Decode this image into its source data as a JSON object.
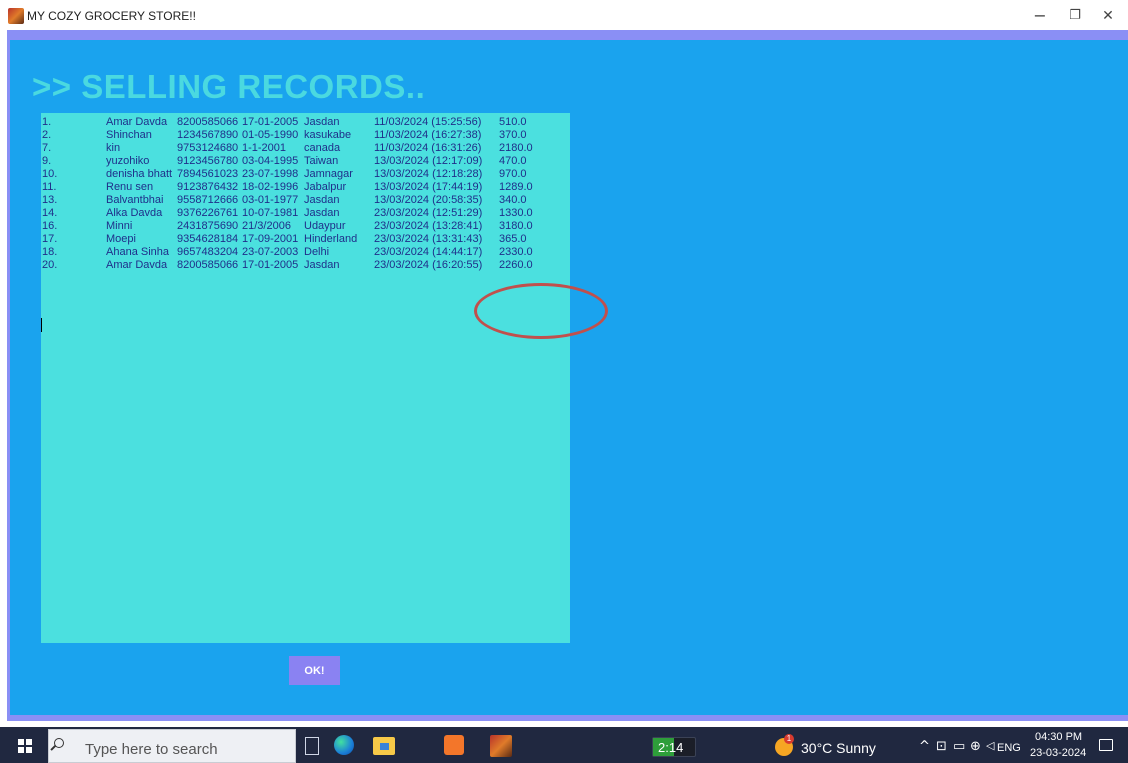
{
  "window": {
    "title": "MY COZY GROCERY STORE!!",
    "minimize_glyph": "−",
    "restore_glyph": "❐",
    "close_glyph": "✕"
  },
  "page": {
    "heading": ">> SELLING RECORDS..",
    "ok_label": "OK!"
  },
  "records": [
    [
      "1.",
      "Amar Davda",
      "8200585066",
      "17-01-2005",
      "Jasdan",
      "11/03/2024 (15:25:56)",
      "510.0"
    ],
    [
      "2.",
      "Shinchan",
      "1234567890",
      "01-05-1990",
      "kasukabe",
      "11/03/2024 (16:27:38)",
      "370.0"
    ],
    [
      "7.",
      "kin",
      "9753124680",
      "1-1-2001",
      "canada",
      "11/03/2024 (16:31:26)",
      "2180.0"
    ],
    [
      "9.",
      "yuzohiko",
      "9123456780",
      "03-04-1995",
      "Taiwan",
      "13/03/2024 (12:17:09)",
      "470.0"
    ],
    [
      "10.",
      "denisha bhatt",
      "7894561023",
      "23-07-1998",
      "Jamnagar",
      "13/03/2024 (12:18:28)",
      "970.0"
    ],
    [
      "11.",
      "Renu sen",
      "9123876432",
      "18-02-1996",
      "Jabalpur",
      "13/03/2024 (17:44:19)",
      "1289.0"
    ],
    [
      "13.",
      "Balvantbhai",
      "9558712666",
      "03-01-1977",
      "Jasdan",
      "13/03/2024 (20:58:35)",
      "340.0"
    ],
    [
      "14.",
      "Alka Davda",
      "9376226761",
      "10-07-1981",
      "Jasdan",
      "23/03/2024 (12:51:29)",
      "1330.0"
    ],
    [
      "16.",
      "Minni",
      "2431875690",
      "21/3/2006",
      "Udaypur",
      "23/03/2024 (13:28:41)",
      "3180.0"
    ],
    [
      "17.",
      "Moepi",
      "9354628184",
      "17-09-2001",
      "Hinderland",
      "23/03/2024 (13:31:43)",
      "365.0"
    ],
    [
      "18.",
      "Ahana Sinha",
      "9657483204",
      "23-07-2003",
      "Delhi",
      "23/03/2024 (14:44:17)",
      "2330.0"
    ],
    [
      "20.",
      "Amar Davda",
      "8200585066",
      "17-01-2005",
      "Jasdan",
      "23/03/2024 (16:20:55)",
      "2260.0"
    ]
  ],
  "taskbar": {
    "search_placeholder": "Type here to search",
    "timer": "2:14",
    "timer_progress": 0.5,
    "weather_badge": "1",
    "weather": "30°C Sunny",
    "tray_chevron": "^",
    "language": "ENG",
    "time": "04:30 PM",
    "date": "23-03-2024"
  },
  "colors": {
    "frame": "#8a8ff5",
    "content_bg": "#1aa3ee",
    "records_bg": "#4be0df",
    "heading": "#4ad9e0",
    "record_text": "#1f2f8a",
    "highlight": "#c0504d",
    "ok_button": "#8a82f2",
    "taskbar": "#202840"
  }
}
